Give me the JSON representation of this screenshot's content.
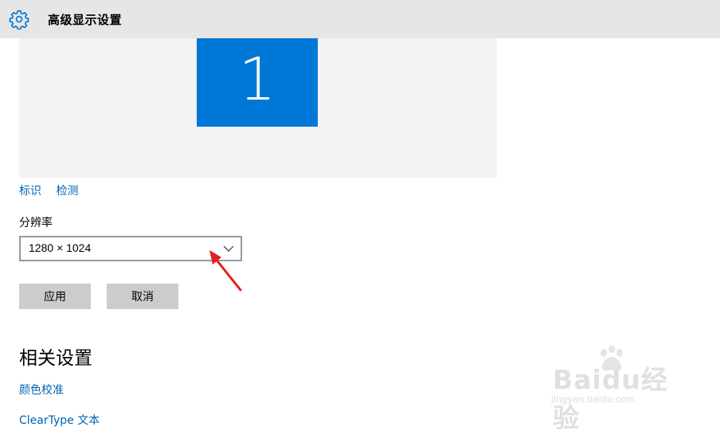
{
  "window": {
    "title": "高级显示设置",
    "icon": "gear-icon"
  },
  "display": {
    "monitor_number": "1",
    "monitor_color": "#0078d7"
  },
  "links": {
    "identify": "标识",
    "detect": "检测"
  },
  "resolution": {
    "label": "分辨率",
    "value": "1280 × 1024"
  },
  "buttons": {
    "apply": "应用",
    "cancel": "取消"
  },
  "related": {
    "title": "相关设置",
    "items": [
      "颜色校准",
      "ClearType 文本"
    ]
  },
  "watermark": {
    "brand": "Baidu经验",
    "domain": "jingyan.baidu.com"
  },
  "colors": {
    "accent": "#0078d7",
    "link": "#0063b1",
    "annotation_arrow": "#e02020"
  }
}
